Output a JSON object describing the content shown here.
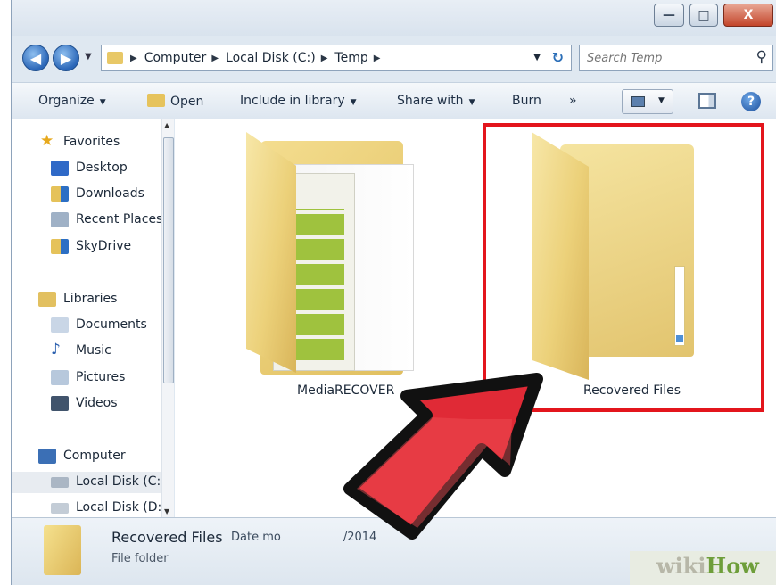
{
  "window": {
    "controls": {
      "minimize": "—",
      "maximize": "□",
      "close": "X"
    }
  },
  "address": {
    "crumbs": [
      "Computer",
      "Local Disk (C:)",
      "Temp"
    ]
  },
  "search": {
    "placeholder": "Search Temp"
  },
  "toolbar": {
    "organize": "Organize",
    "open": "Open",
    "include_in_library": "Include in library",
    "share_with": "Share with",
    "burn": "Burn",
    "more": "»",
    "help": "?"
  },
  "navigation": {
    "favorites": {
      "label": "Favorites",
      "items": [
        "Desktop",
        "Downloads",
        "Recent Places",
        "SkyDrive"
      ]
    },
    "libraries": {
      "label": "Libraries",
      "items": [
        "Documents",
        "Music",
        "Pictures",
        "Videos"
      ]
    },
    "computer": {
      "label": "Computer",
      "items": [
        "Local Disk (C:",
        "Local Disk (D:"
      ]
    }
  },
  "files": [
    {
      "name": "MediaRECOVER",
      "type": "folder-with-document"
    },
    {
      "name": "Recovered Files",
      "type": "folder",
      "highlighted": true
    }
  ],
  "details": {
    "name": "Recovered Files",
    "date_fragment": "Date mo",
    "date_tail": "/2014",
    "type": "File folder"
  },
  "watermark": {
    "wiki": "wiki",
    "how": "How"
  },
  "colors": {
    "highlight": "#e3151c",
    "arrow": "#e02a36",
    "folder": "#ecd17a"
  }
}
